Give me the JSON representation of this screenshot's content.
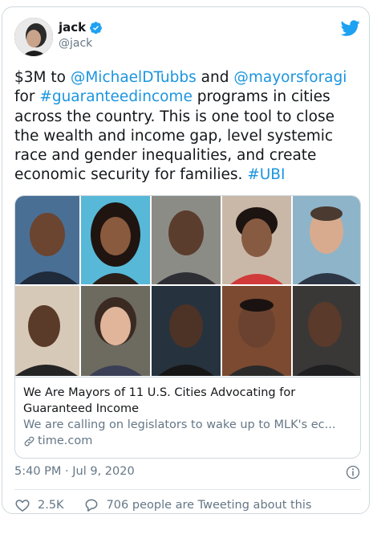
{
  "tweet": {
    "author_name": "jack",
    "author_handle": "@jack",
    "text": {
      "t1": "$3M to ",
      "m1": "@MichaelDTubbs",
      "t2": " and ",
      "m2": "@mayorsforagi",
      "t3": " for ",
      "h1": "#guaranteedincome",
      "t4": " programs in cities across the country. This is one tool to close the wealth and income gap, level systemic race and gender inequalities, and create economic security for families. ",
      "h2": "#UBI"
    },
    "card": {
      "title": "We Are Mayors of 11 U.S. Cities Advocating for Guaranteed Income",
      "description": "We are calling on legislators to wake up to MLK's ec...",
      "domain": "time.com"
    },
    "timestamp": "5:40 PM · Jul 9, 2020",
    "likes": "2.5K",
    "replies_text": "706 people are Tweeting about this"
  },
  "icons": {
    "verified": "verified-badge-icon",
    "platform": "twitter-bird-icon",
    "info": "info-icon",
    "like": "heart-icon",
    "reply": "speech-bubble-icon",
    "link": "link-icon"
  },
  "colors": {
    "link": "#1b95e0",
    "text": "#14171a",
    "muted": "#657786",
    "border": "#cfd9de"
  }
}
